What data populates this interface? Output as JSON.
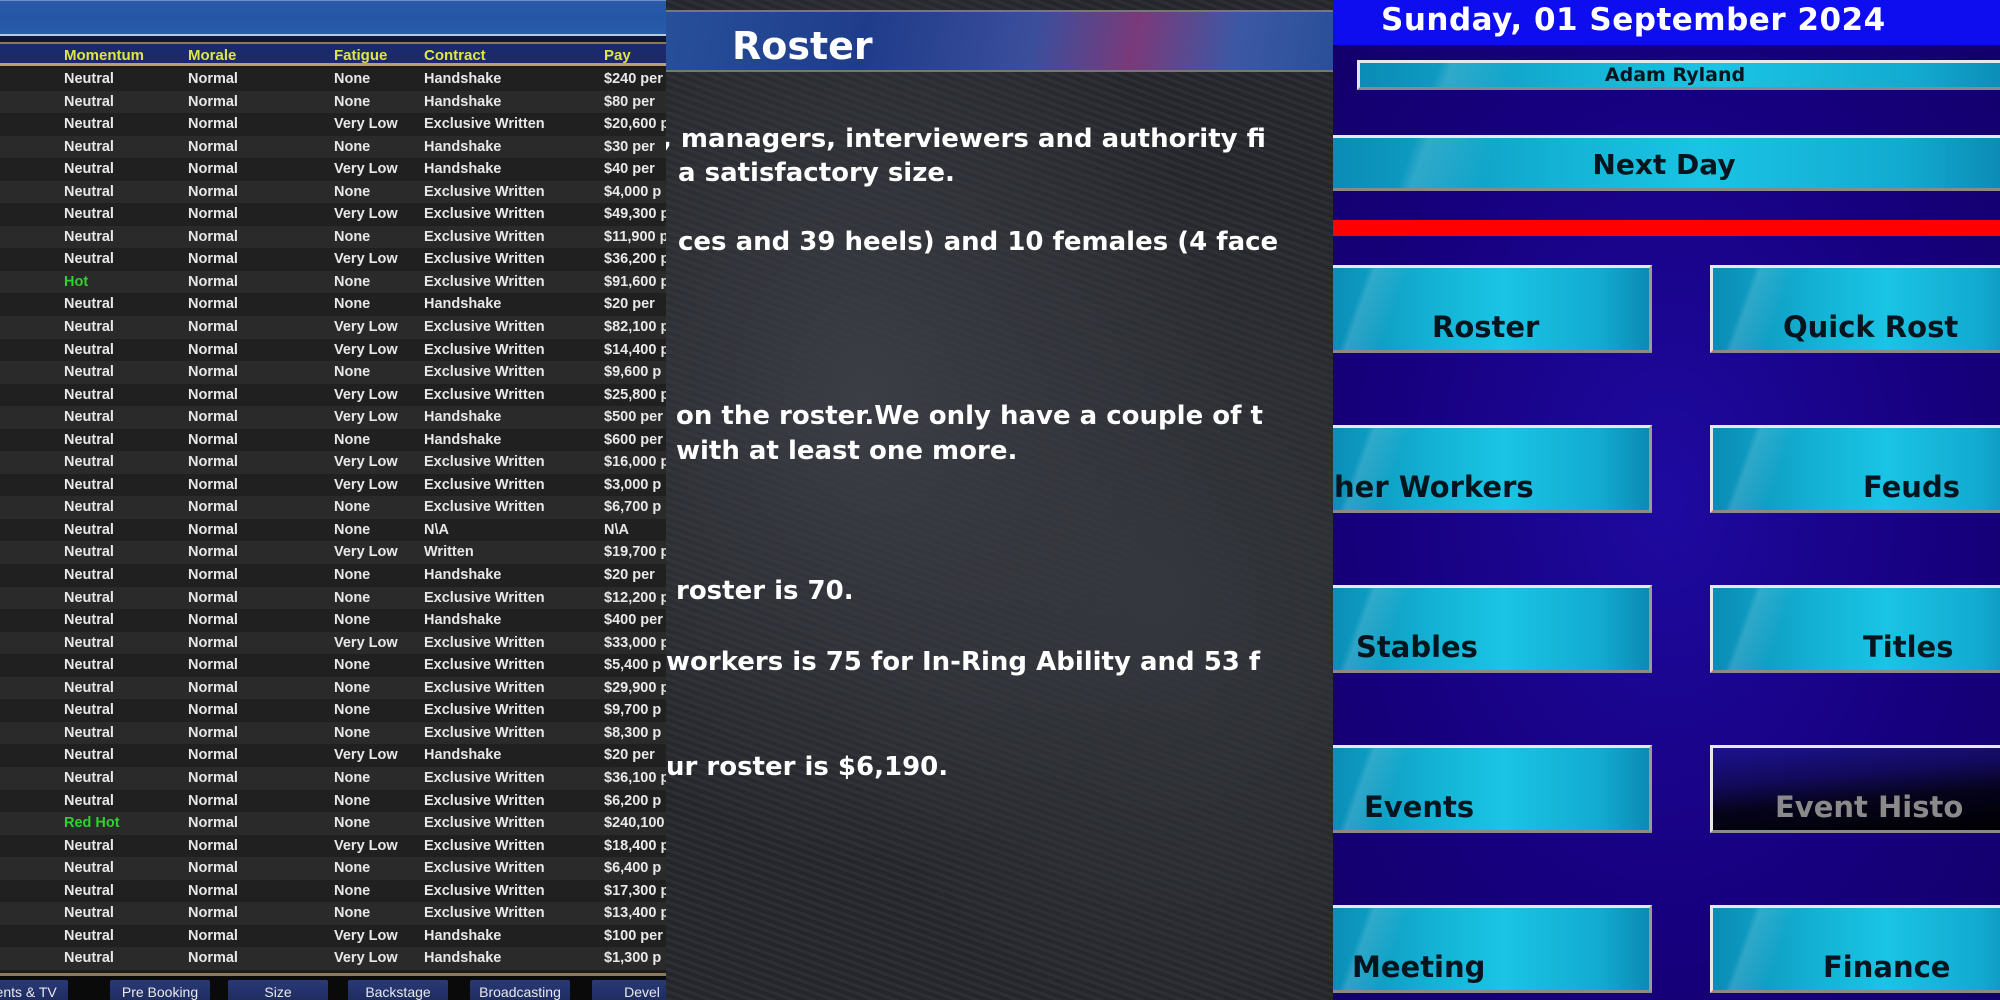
{
  "roster_table": {
    "columns": [
      "Momentum",
      "Morale",
      "Fatigue",
      "Contract",
      "Pay"
    ],
    "rows": [
      {
        "momentum": "Neutral",
        "morale": "Normal",
        "fatigue": "None",
        "contract": "Handshake",
        "pay": "$240 per"
      },
      {
        "momentum": "Neutral",
        "morale": "Normal",
        "fatigue": "None",
        "contract": "Handshake",
        "pay": "$80 per"
      },
      {
        "momentum": "Neutral",
        "morale": "Normal",
        "fatigue": "Very Low",
        "contract": "Exclusive Written",
        "pay": "$20,600 p"
      },
      {
        "momentum": "Neutral",
        "morale": "Normal",
        "fatigue": "None",
        "contract": "Handshake",
        "pay": "$30 per"
      },
      {
        "momentum": "Neutral",
        "morale": "Normal",
        "fatigue": "Very Low",
        "contract": "Handshake",
        "pay": "$40 per"
      },
      {
        "momentum": "Neutral",
        "morale": "Normal",
        "fatigue": "None",
        "contract": "Exclusive Written",
        "pay": "$4,000 p"
      },
      {
        "momentum": "Neutral",
        "morale": "Normal",
        "fatigue": "Very Low",
        "contract": "Exclusive Written",
        "pay": "$49,300 p"
      },
      {
        "momentum": "Neutral",
        "morale": "Normal",
        "fatigue": "None",
        "contract": "Exclusive Written",
        "pay": "$11,900 p"
      },
      {
        "momentum": "Neutral",
        "morale": "Normal",
        "fatigue": "Very Low",
        "contract": "Exclusive Written",
        "pay": "$36,200 p"
      },
      {
        "momentum": "Hot",
        "morale": "Normal",
        "fatigue": "None",
        "contract": "Exclusive Written",
        "pay": "$91,600 p"
      },
      {
        "momentum": "Neutral",
        "morale": "Normal",
        "fatigue": "None",
        "contract": "Handshake",
        "pay": "$20 per"
      },
      {
        "momentum": "Neutral",
        "morale": "Normal",
        "fatigue": "Very Low",
        "contract": "Exclusive Written",
        "pay": "$82,100 p"
      },
      {
        "momentum": "Neutral",
        "morale": "Normal",
        "fatigue": "Very Low",
        "contract": "Exclusive Written",
        "pay": "$14,400 p"
      },
      {
        "momentum": "Neutral",
        "morale": "Normal",
        "fatigue": "None",
        "contract": "Exclusive Written",
        "pay": "$9,600 p"
      },
      {
        "momentum": "Neutral",
        "morale": "Normal",
        "fatigue": "Very Low",
        "contract": "Exclusive Written",
        "pay": "$25,800 p"
      },
      {
        "momentum": "Neutral",
        "morale": "Normal",
        "fatigue": "Very Low",
        "contract": "Handshake",
        "pay": "$500 per"
      },
      {
        "momentum": "Neutral",
        "morale": "Normal",
        "fatigue": "None",
        "contract": "Handshake",
        "pay": "$600 per"
      },
      {
        "momentum": "Neutral",
        "morale": "Normal",
        "fatigue": "Very Low",
        "contract": "Exclusive Written",
        "pay": "$16,000 p"
      },
      {
        "momentum": "Neutral",
        "morale": "Normal",
        "fatigue": "Very Low",
        "contract": "Exclusive Written",
        "pay": "$3,000 p"
      },
      {
        "momentum": "Neutral",
        "morale": "Normal",
        "fatigue": "None",
        "contract": "Exclusive Written",
        "pay": "$6,700 p"
      },
      {
        "momentum": "Neutral",
        "morale": "Normal",
        "fatigue": "None",
        "contract": "N\\A",
        "pay": "N\\A"
      },
      {
        "momentum": "Neutral",
        "morale": "Normal",
        "fatigue": "Very Low",
        "contract": "Written",
        "pay": "$19,700 p"
      },
      {
        "momentum": "Neutral",
        "morale": "Normal",
        "fatigue": "None",
        "contract": "Handshake",
        "pay": "$20 per"
      },
      {
        "momentum": "Neutral",
        "morale": "Normal",
        "fatigue": "None",
        "contract": "Exclusive Written",
        "pay": "$12,200 p"
      },
      {
        "momentum": "Neutral",
        "morale": "Normal",
        "fatigue": "None",
        "contract": "Handshake",
        "pay": "$400 per"
      },
      {
        "momentum": "Neutral",
        "morale": "Normal",
        "fatigue": "Very Low",
        "contract": "Exclusive Written",
        "pay": "$33,000 p"
      },
      {
        "momentum": "Neutral",
        "morale": "Normal",
        "fatigue": "None",
        "contract": "Exclusive Written",
        "pay": "$5,400 p"
      },
      {
        "momentum": "Neutral",
        "morale": "Normal",
        "fatigue": "None",
        "contract": "Exclusive Written",
        "pay": "$29,900 p"
      },
      {
        "momentum": "Neutral",
        "morale": "Normal",
        "fatigue": "None",
        "contract": "Exclusive Written",
        "pay": "$9,700 p"
      },
      {
        "momentum": "Neutral",
        "morale": "Normal",
        "fatigue": "None",
        "contract": "Exclusive Written",
        "pay": "$8,300 p"
      },
      {
        "momentum": "Neutral",
        "morale": "Normal",
        "fatigue": "Very Low",
        "contract": "Handshake",
        "pay": "$20 per"
      },
      {
        "momentum": "Neutral",
        "morale": "Normal",
        "fatigue": "None",
        "contract": "Exclusive Written",
        "pay": "$36,100 p"
      },
      {
        "momentum": "Neutral",
        "morale": "Normal",
        "fatigue": "None",
        "contract": "Exclusive Written",
        "pay": "$6,200 p"
      },
      {
        "momentum": "Red Hot",
        "morale": "Normal",
        "fatigue": "None",
        "contract": "Exclusive Written",
        "pay": "$240,100"
      },
      {
        "momentum": "Neutral",
        "morale": "Normal",
        "fatigue": "Very Low",
        "contract": "Exclusive Written",
        "pay": "$18,400 p"
      },
      {
        "momentum": "Neutral",
        "morale": "Normal",
        "fatigue": "None",
        "contract": "Exclusive Written",
        "pay": "$6,400 p"
      },
      {
        "momentum": "Neutral",
        "morale": "Normal",
        "fatigue": "None",
        "contract": "Exclusive Written",
        "pay": "$17,300 p"
      },
      {
        "momentum": "Neutral",
        "morale": "Normal",
        "fatigue": "None",
        "contract": "Exclusive Written",
        "pay": "$13,400 p"
      },
      {
        "momentum": "Neutral",
        "morale": "Normal",
        "fatigue": "Very Low",
        "contract": "Handshake",
        "pay": "$100 per"
      },
      {
        "momentum": "Neutral",
        "morale": "Normal",
        "fatigue": "Very Low",
        "contract": "Handshake",
        "pay": "$1,300 p"
      }
    ],
    "hot_color": "#2fd02f",
    "tabs": [
      "Events & TV",
      "Pre Booking",
      "Size",
      "Backstage",
      "Broadcasting",
      "Devel"
    ]
  },
  "report": {
    "title": "Roster",
    "paragraphs": [
      ", managers, interviewers and authority fi",
      "a satisfactory size.",
      "ces and 39 heels) and 10 females (4 face",
      "on the roster.We only have a couple of t",
      "with at least one more.",
      "roster is 70.",
      "workers is 75 for In-Ring Ability and 53 f",
      "ur roster is $6,190."
    ]
  },
  "menu": {
    "date": "Sunday, 01 September 2024",
    "user_name": "Adam Ryland",
    "next_day_label": "Next Day",
    "buttons": [
      {
        "label": "Roster",
        "enabled": true
      },
      {
        "label": "Quick Rost",
        "enabled": true
      },
      {
        "label": "her Workers",
        "enabled": true
      },
      {
        "label": "Feuds",
        "enabled": true
      },
      {
        "label": "Stables",
        "enabled": true
      },
      {
        "label": "Titles",
        "enabled": true
      },
      {
        "label": "Events",
        "enabled": true
      },
      {
        "label": "Event Histo",
        "enabled": false
      },
      {
        "label": "Meeting",
        "enabled": true
      },
      {
        "label": "Finance",
        "enabled": true
      }
    ],
    "accent_color": "#ff0000"
  }
}
